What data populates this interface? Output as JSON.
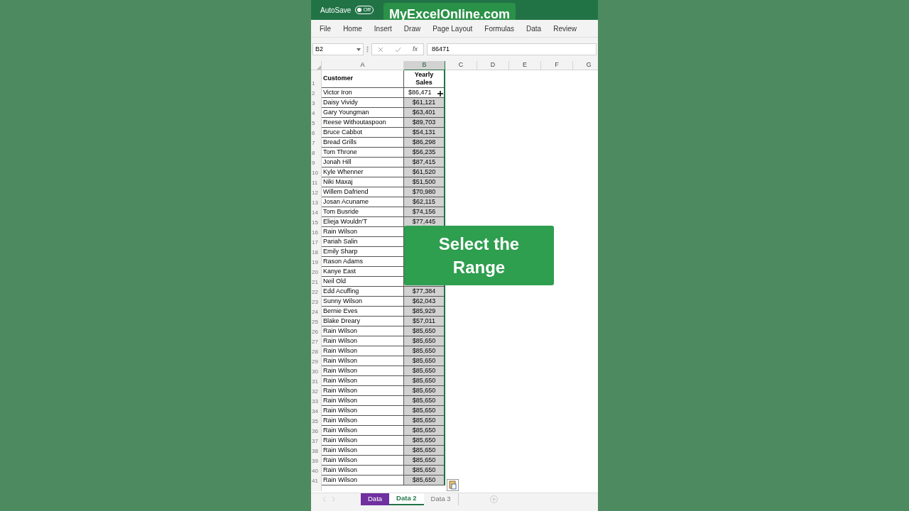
{
  "title_bar": {
    "autosave_label": "AutoSave",
    "autosave_toggle": {
      "label": "Off",
      "on": false
    },
    "brand": "MyExcelOnline.com"
  },
  "ribbon_tabs": [
    "File",
    "Home",
    "Insert",
    "Draw",
    "Page Layout",
    "Formulas",
    "Data",
    "Review"
  ],
  "formula_bar": {
    "name_box": "B2",
    "function_label": "fx",
    "value": "86471"
  },
  "columns": [
    {
      "label": "A",
      "selected": false
    },
    {
      "label": "B",
      "selected": true
    },
    {
      "label": "C",
      "selected": false
    },
    {
      "label": "D",
      "selected": false
    },
    {
      "label": "E",
      "selected": false
    },
    {
      "label": "F",
      "selected": false
    },
    {
      "label": "G",
      "selected": false
    }
  ],
  "header_row": {
    "num": "1",
    "customer": "Customer",
    "sales": "Yearly Sales"
  },
  "rows": [
    {
      "num": "2",
      "customer": "Victor Iron",
      "sales": "$86,471",
      "active": true
    },
    {
      "num": "3",
      "customer": "Daisy Vividy",
      "sales": "$61,121",
      "active": false
    },
    {
      "num": "4",
      "customer": "Gary Youngman",
      "sales": "$63,401",
      "active": false
    },
    {
      "num": "5",
      "customer": "Reese Withoutaspoon",
      "sales": "$89,703",
      "active": false
    },
    {
      "num": "6",
      "customer": "Bruce Cabbot",
      "sales": "$54,131",
      "active": false
    },
    {
      "num": "7",
      "customer": "Bread Grills",
      "sales": "$86,298",
      "active": false
    },
    {
      "num": "8",
      "customer": "Tom Throne",
      "sales": "$56,235",
      "active": false
    },
    {
      "num": "9",
      "customer": "Jonah Hill",
      "sales": "$87,415",
      "active": false
    },
    {
      "num": "10",
      "customer": "Kyle Whenner",
      "sales": "$61,520",
      "active": false
    },
    {
      "num": "11",
      "customer": "Niki Maxaj",
      "sales": "$51,500",
      "active": false
    },
    {
      "num": "12",
      "customer": "Willem Dafriend",
      "sales": "$70,980",
      "active": false
    },
    {
      "num": "13",
      "customer": "Josan Acuname",
      "sales": "$62,115",
      "active": false
    },
    {
      "num": "14",
      "customer": "Tom Busride",
      "sales": "$74,156",
      "active": false
    },
    {
      "num": "15",
      "customer": "Elieja Wouldn'T",
      "sales": "$77,445",
      "active": false
    },
    {
      "num": "16",
      "customer": "Rain Wilson"
    },
    {
      "num": "17",
      "customer": "Pariah Salin"
    },
    {
      "num": "18",
      "customer": "Emily Sharp"
    },
    {
      "num": "19",
      "customer": "Rason Adams"
    },
    {
      "num": "20",
      "customer": "Kanye East"
    },
    {
      "num": "21",
      "customer": "Neil Old"
    },
    {
      "num": "22",
      "customer": "Edd Acuffing",
      "sales": "$77,384",
      "active": false
    },
    {
      "num": "23",
      "customer": "Sunny Wilson",
      "sales": "$62,043",
      "active": false
    },
    {
      "num": "24",
      "customer": "Bernie Eves",
      "sales": "$85,929",
      "active": false
    },
    {
      "num": "25",
      "customer": "Blake Dreary",
      "sales": "$57,011",
      "active": false
    },
    {
      "num": "26",
      "customer": "Rain Wilson",
      "sales": "$85,650",
      "active": false
    },
    {
      "num": "27",
      "customer": "Rain Wilson",
      "sales": "$85,650",
      "active": false
    },
    {
      "num": "28",
      "customer": "Rain Wilson",
      "sales": "$85,650",
      "active": false
    },
    {
      "num": "29",
      "customer": "Rain Wilson",
      "sales": "$85,650",
      "active": false
    },
    {
      "num": "30",
      "customer": "Rain Wilson",
      "sales": "$85,650",
      "active": false
    },
    {
      "num": "31",
      "customer": "Rain Wilson",
      "sales": "$85,650",
      "active": false
    },
    {
      "num": "32",
      "customer": "Rain Wilson",
      "sales": "$85,650",
      "active": false
    },
    {
      "num": "33",
      "customer": "Rain Wilson",
      "sales": "$85,650",
      "active": false
    },
    {
      "num": "34",
      "customer": "Rain Wilson",
      "sales": "$85,650",
      "active": false
    },
    {
      "num": "35",
      "customer": "Rain Wilson",
      "sales": "$85,650",
      "active": false
    },
    {
      "num": "36",
      "customer": "Rain Wilson",
      "sales": "$85,650",
      "active": false
    },
    {
      "num": "37",
      "customer": "Rain Wilson",
      "sales": "$85,650",
      "active": false
    },
    {
      "num": "38",
      "customer": "Rain Wilson",
      "sales": "$85,650",
      "active": false
    },
    {
      "num": "39",
      "customer": "Rain Wilson",
      "sales": "$85,650",
      "active": false
    },
    {
      "num": "40",
      "customer": "Rain Wilson",
      "sales": "$85,650",
      "active": false
    },
    {
      "num": "41",
      "customer": "Rain Wilson",
      "sales": "$85,650",
      "active": false
    }
  ],
  "sheet_tabs": [
    {
      "label": "Data",
      "selected": false,
      "color": "#7030a0"
    },
    {
      "label": "Data 2",
      "selected": true
    },
    {
      "label": "Data 3",
      "selected": false
    }
  ],
  "callout": "Select the Range"
}
